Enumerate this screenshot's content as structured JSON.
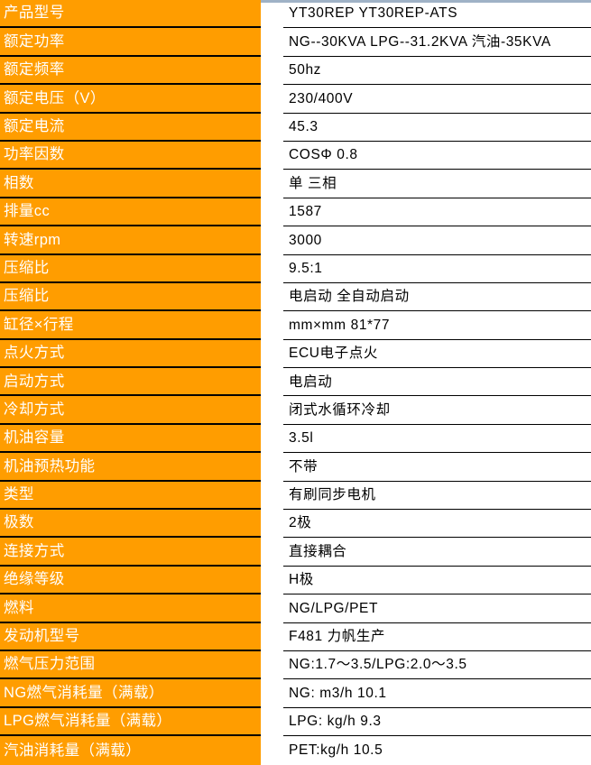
{
  "table": {
    "accent_color": "#ff9d00",
    "label_text_color": "#ffffff",
    "value_text_color": "#000000",
    "top_rule_color": "#9fb2c6",
    "rows": [
      {
        "label": "产品型号",
        "value": "YT30REP  YT30REP-ATS"
      },
      {
        "label": "额定功率",
        "value": "NG--30KVA  LPG--31.2KVA  汽油-35KVA"
      },
      {
        "label": "额定频率",
        "value": "50hz"
      },
      {
        "label": "额定电压（V）",
        "value": "230/400V"
      },
      {
        "label": "额定电流",
        "value": "45.3"
      },
      {
        "label": "功率因数",
        "value": "COSΦ  0.8"
      },
      {
        "label": "相数",
        "value": "单  三相"
      },
      {
        "label": "排量cc",
        "value": "1587"
      },
      {
        "label": "转速rpm",
        "value": "3000"
      },
      {
        "label": "压缩比",
        "value": "9.5:1"
      },
      {
        "label": "压缩比",
        "value": "电启动  全自动启动"
      },
      {
        "label": "缸径×行程",
        "value": "mm×mm  81*77"
      },
      {
        "label": "点火方式",
        "value": "ECU电子点火"
      },
      {
        "label": "启动方式",
        "value": "电启动"
      },
      {
        "label": "冷却方式",
        "value": "闭式水循环冷却"
      },
      {
        "label": "机油容量",
        "value": "3.5l"
      },
      {
        "label": "机油预热功能",
        "value": "不带"
      },
      {
        "label": "类型",
        "value": "有刷同步电机"
      },
      {
        "label": "极数",
        "value": "2极"
      },
      {
        "label": "连接方式",
        "value": "直接耦合"
      },
      {
        "label": "绝缘等级",
        "value": "H极"
      },
      {
        "label": "燃料",
        "value": "NG/LPG/PET"
      },
      {
        "label": "发动机型号",
        "value": "F481  力帆生产"
      },
      {
        "label": "燃气压力范围",
        "value": "NG:1.7～3.5/LPG:2.0～3.5"
      },
      {
        "label": "NG燃气消耗量（满载）",
        "value": "NG:  m3/h 10.1"
      },
      {
        "label": "LPG燃气消耗量（满载）",
        "value": "LPG:  kg/h 9.3"
      },
      {
        "label": "汽油消耗量（满载）",
        "value": "PET:kg/h 10.5"
      }
    ]
  }
}
